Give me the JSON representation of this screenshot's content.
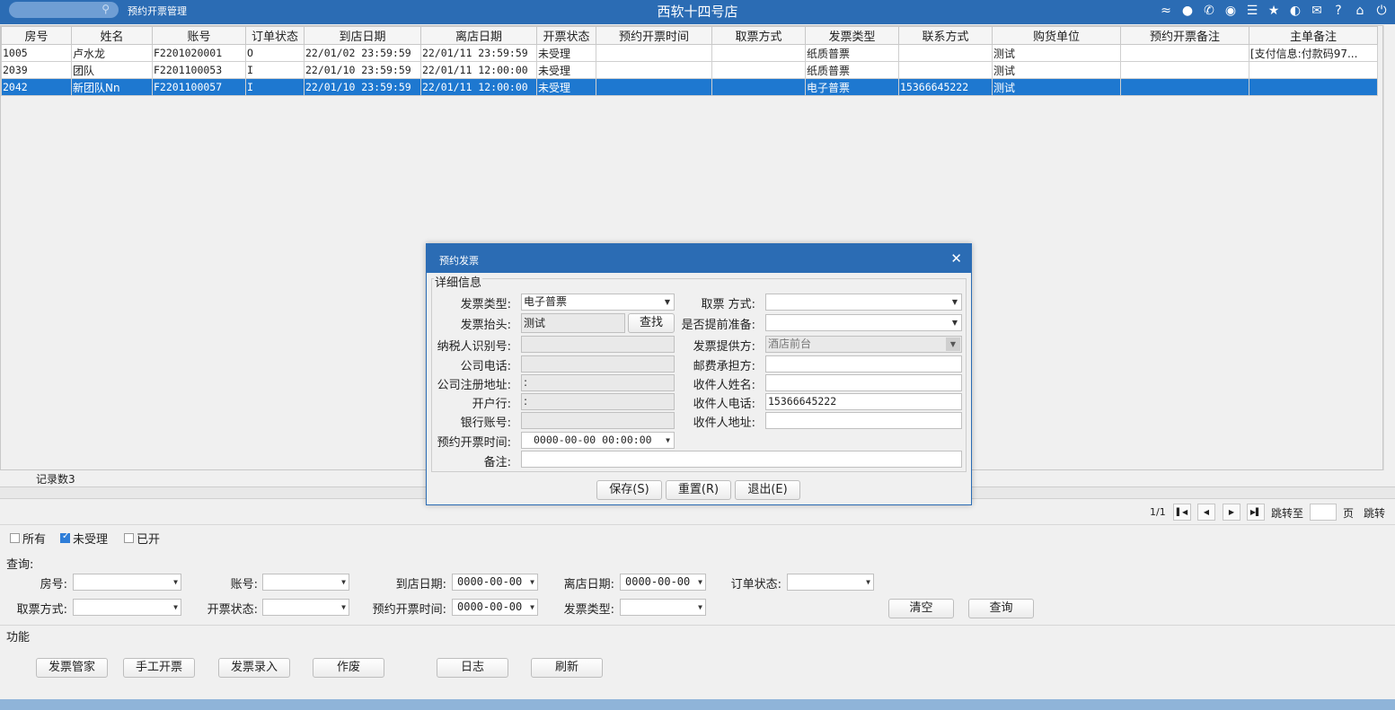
{
  "titlebar": {
    "module": "预约开票管理",
    "title": "西软十四号店",
    "icons": [
      "wifi-icon",
      "chat-icon",
      "phone-icon",
      "palette-icon",
      "menu-icon",
      "star-icon",
      "contrast-icon",
      "mail-icon",
      "help-icon",
      "home-icon",
      "power-icon"
    ]
  },
  "grid": {
    "columns": [
      "房号",
      "姓名",
      "账号",
      "订单状态",
      "到店日期",
      "离店日期",
      "开票状态",
      "预约开票时间",
      "取票方式",
      "发票类型",
      "联系方式",
      "购货单位",
      "预约开票备注",
      "主单备注"
    ],
    "rows": [
      [
        "1005",
        "卢水龙",
        "F2201020001",
        "O",
        "22/01/02 23:59:59",
        "22/01/11 23:59:59",
        "未受理",
        "",
        "",
        "纸质普票",
        "",
        "测试",
        "",
        "[支付信息:付款码97..."
      ],
      [
        "2039",
        "团队",
        "F2201100053",
        "I",
        "22/01/10 23:59:59",
        "22/01/11 12:00:00",
        "未受理",
        "",
        "",
        "纸质普票",
        "",
        "测试",
        "",
        ""
      ],
      [
        "2042",
        "新团队Nn",
        "F2201100057",
        "I",
        "22/01/10 23:59:59",
        "22/01/11 12:00:00",
        "未受理",
        "",
        "",
        "电子普票",
        "15366645222",
        "测试",
        "",
        ""
      ]
    ],
    "selected_row": 2,
    "record_count": "记录数3"
  },
  "pager": {
    "page": "1/1",
    "jump_to": "跳转至",
    "page_unit": "页",
    "jump": "跳转"
  },
  "filter": {
    "all": "所有",
    "pending": "未受理",
    "issued": "已开",
    "pending_checked": true
  },
  "query": {
    "title": "查询:",
    "room_no": "房号:",
    "account_no": "账号:",
    "arrival_date": "到店日期:",
    "arrival_value": "0000-00-00",
    "departure_date": "离店日期:",
    "departure_value": "0000-00-00",
    "order_status": "订单状态:",
    "pickup_method": "取票方式:",
    "invoice_status": "开票状态:",
    "scheduled_time": "预约开票时间:",
    "scheduled_value": "0000-00-00",
    "invoice_type": "发票类型:",
    "clear": "清空",
    "search": "查询"
  },
  "functions": {
    "title": "功能",
    "buttons": [
      "发票管家",
      "手工开票",
      "发票录入",
      "作废",
      "日志",
      "刷新"
    ]
  },
  "dialog": {
    "title": "预约发票",
    "group": "详细信息",
    "invoice_type_label": "发票类型:",
    "invoice_type_value": "电子普票",
    "pickup_label": "取票  方式:",
    "invoice_header_label": "发票抬头:",
    "invoice_header_value": "测试",
    "lookup": "查找",
    "prepare_label": "是否提前准备:",
    "taxpayer_id_label": "纳税人识别号:",
    "provider_label": "发票提供方:",
    "provider_value": "酒店前台",
    "company_phone_label": "公司电话:",
    "postage_label": "邮费承担方:",
    "reg_address_label": "公司注册地址:",
    "reg_address_value": ":",
    "receiver_name_label": "收件人姓名:",
    "bank_label": "开户行:",
    "bank_value": ":",
    "receiver_phone_label": "收件人电话:",
    "receiver_phone_value": "15366645222",
    "bank_account_label": "银行账号:",
    "receiver_address_label": "收件人地址:",
    "scheduled_label": "预约开票时间:",
    "scheduled_value": "0000-00-00 00:00:00",
    "remark_label": "备注:",
    "save": "保存(S)",
    "reset": "重置(R)",
    "exit": "退出(E)"
  }
}
